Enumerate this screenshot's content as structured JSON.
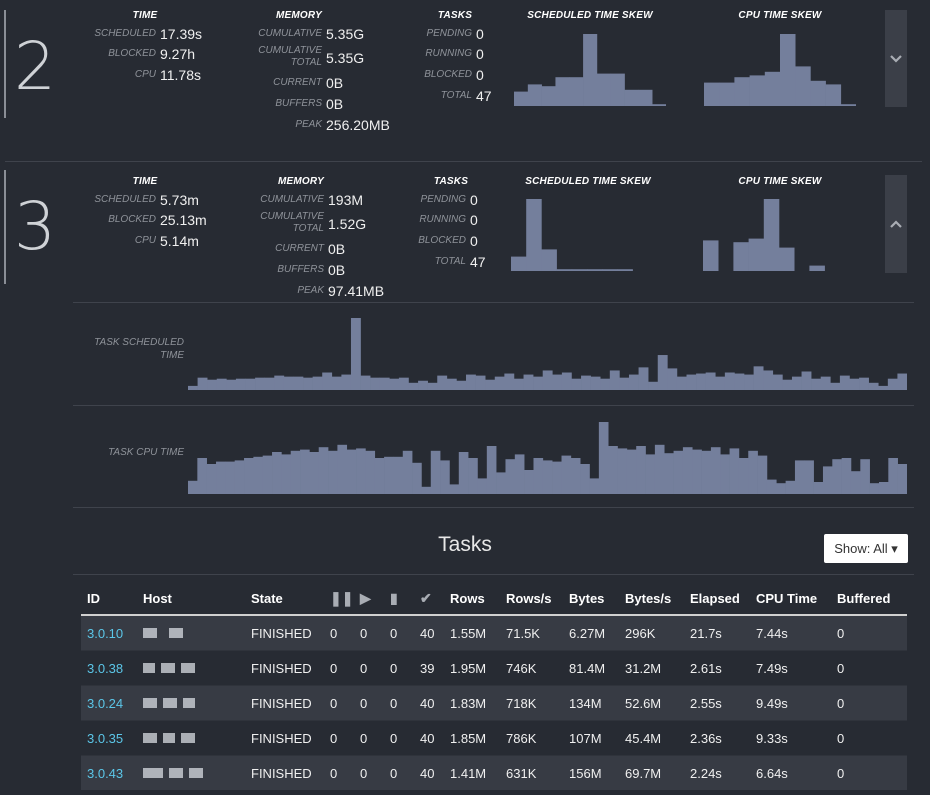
{
  "stages": [
    {
      "number": "2",
      "headers": {
        "time": "TIME",
        "memory": "MEMORY",
        "tasks": "TASKS",
        "sched_skew": "SCHEDULED TIME SKEW",
        "cpu_skew": "CPU TIME SKEW"
      },
      "time": {
        "scheduled_label": "SCHEDULED",
        "scheduled": "17.39s",
        "blocked_label": "BLOCKED",
        "blocked": "9.27h",
        "cpu_label": "CPU",
        "cpu": "11.78s"
      },
      "memory": {
        "cumulative_label": "CUMULATIVE",
        "cumulative": "5.35G",
        "cumulative_total_label1": "CUMULATIVE",
        "cumulative_total_label2": "TOTAL",
        "cumulative_total": "5.35G",
        "current_label": "CURRENT",
        "current": "0B",
        "buffers_label": "BUFFERS",
        "buffers": "0B",
        "peak_label": "PEAK",
        "peak": "256.20MB"
      },
      "tasks": {
        "pending_label": "PENDING",
        "pending": "0",
        "running_label": "RUNNING",
        "running": "0",
        "blocked_label": "BLOCKED",
        "blocked": "0",
        "total_label": "TOTAL",
        "total": "47"
      },
      "sched_skew": [
        8,
        12,
        11,
        16,
        16,
        40,
        18,
        18,
        9,
        9,
        1
      ],
      "cpu_skew": [
        13,
        13,
        16,
        17,
        19,
        40,
        22,
        14,
        12,
        1
      ],
      "toggle_icon": "chevron-down-icon"
    },
    {
      "number": "3",
      "headers": {
        "time": "TIME",
        "memory": "MEMORY",
        "tasks": "TASKS",
        "sched_skew": "SCHEDULED TIME SKEW",
        "cpu_skew": "CPU TIME SKEW"
      },
      "time": {
        "scheduled_label": "SCHEDULED",
        "scheduled": "5.73m",
        "blocked_label": "BLOCKED",
        "blocked": "25.13m",
        "cpu_label": "CPU",
        "cpu": "5.14m"
      },
      "memory": {
        "cumulative_label": "CUMULATIVE",
        "cumulative": "193M",
        "cumulative_total_label1": "CUMULATIVE",
        "cumulative_total_label2": "TOTAL",
        "cumulative_total": "1.52G",
        "current_label": "CURRENT",
        "current": "0B",
        "buffers_label": "BUFFERS",
        "buffers": "0B",
        "peak_label": "PEAK",
        "peak": "97.41MB"
      },
      "tasks": {
        "pending_label": "PENDING",
        "pending": "0",
        "running_label": "RUNNING",
        "running": "0",
        "blocked_label": "BLOCKED",
        "blocked": "0",
        "total_label": "TOTAL",
        "total": "47"
      },
      "sched_skew": [
        8,
        40,
        12,
        1,
        1,
        1,
        1,
        1,
        0,
        0
      ],
      "cpu_skew": [
        17,
        0,
        16,
        18,
        40,
        13,
        0,
        3,
        0,
        0
      ],
      "toggle_icon": "chevron-up-icon",
      "task_scheduled_label1": "TASK SCHEDULED",
      "task_scheduled_label2": "TIME",
      "task_cpu_label": "TASK CPU TIME",
      "task_scheduled_series": [
        4,
        12,
        10,
        11,
        10,
        11,
        11,
        12,
        12,
        14,
        13,
        13,
        12,
        13,
        17,
        13,
        15,
        70,
        14,
        12,
        12,
        11,
        12,
        7,
        9,
        7,
        14,
        11,
        9,
        15,
        14,
        10,
        13,
        16,
        11,
        15,
        13,
        19,
        15,
        17,
        11,
        14,
        13,
        11,
        19,
        12,
        15,
        22,
        8,
        34,
        21,
        13,
        15,
        16,
        17,
        13,
        17,
        16,
        15,
        23,
        19,
        15,
        10,
        13,
        18,
        11,
        13,
        7,
        14,
        11,
        12,
        7,
        4,
        11,
        16
      ],
      "task_cpu_series": [
        11,
        30,
        25,
        27,
        27,
        28,
        30,
        31,
        32,
        35,
        33,
        36,
        37,
        35,
        39,
        36,
        41,
        37,
        38,
        36,
        30,
        31,
        31,
        36,
        26,
        6,
        36,
        28,
        8,
        35,
        30,
        13,
        40,
        18,
        29,
        33,
        20,
        30,
        28,
        27,
        32,
        30,
        25,
        13,
        60,
        40,
        38,
        37,
        40,
        33,
        41,
        34,
        36,
        39,
        37,
        36,
        39,
        33,
        38,
        30,
        36,
        32,
        12,
        9,
        11,
        28,
        28,
        10,
        23,
        29,
        30,
        19,
        29,
        9,
        10,
        30,
        25
      ]
    }
  ],
  "tasks_section": {
    "title": "Tasks",
    "show_button": "Show: All ▾",
    "columns": [
      "ID",
      "Host",
      "State",
      "",
      "",
      "",
      "",
      "Rows",
      "Rows/s",
      "Bytes",
      "Bytes/s",
      "Elapsed",
      "CPU Time",
      "Buffered"
    ],
    "column_icons": [
      "pause-icon",
      "play-icon",
      "bookmark-icon",
      "check-icon"
    ],
    "rows": [
      {
        "id": "3.0.10",
        "state": "FINISHED",
        "c1": "0",
        "c2": "0",
        "c3": "0",
        "c4": "40",
        "rows": "1.55M",
        "rows_s": "71.5K",
        "bytes": "6.27M",
        "bytes_s": "296K",
        "elapsed": "21.7s",
        "cpu": "7.44s",
        "buffered": "0"
      },
      {
        "id": "3.0.38",
        "state": "FINISHED",
        "c1": "0",
        "c2": "0",
        "c3": "0",
        "c4": "39",
        "rows": "1.95M",
        "rows_s": "746K",
        "bytes": "81.4M",
        "bytes_s": "31.2M",
        "elapsed": "2.61s",
        "cpu": "7.49s",
        "buffered": "0"
      },
      {
        "id": "3.0.24",
        "state": "FINISHED",
        "c1": "0",
        "c2": "0",
        "c3": "0",
        "c4": "40",
        "rows": "1.83M",
        "rows_s": "718K",
        "bytes": "134M",
        "bytes_s": "52.6M",
        "elapsed": "2.55s",
        "cpu": "9.49s",
        "buffered": "0"
      },
      {
        "id": "3.0.35",
        "state": "FINISHED",
        "c1": "0",
        "c2": "0",
        "c3": "0",
        "c4": "40",
        "rows": "1.85M",
        "rows_s": "786K",
        "bytes": "107M",
        "bytes_s": "45.4M",
        "elapsed": "2.36s",
        "cpu": "9.33s",
        "buffered": "0"
      },
      {
        "id": "3.0.43",
        "state": "FINISHED",
        "c1": "0",
        "c2": "0",
        "c3": "0",
        "c4": "40",
        "rows": "1.41M",
        "rows_s": "631K",
        "bytes": "156M",
        "bytes_s": "69.7M",
        "elapsed": "2.24s",
        "cpu": "6.64s",
        "buffered": "0"
      }
    ]
  }
}
